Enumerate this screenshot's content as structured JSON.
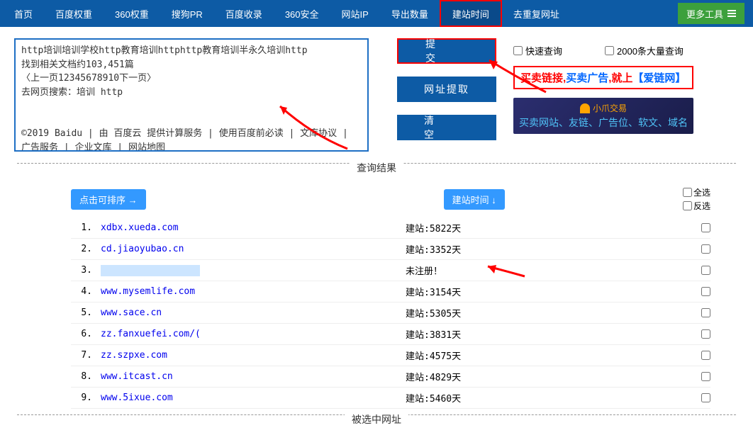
{
  "nav": {
    "items": [
      {
        "label": "首页"
      },
      {
        "label": "百度权重"
      },
      {
        "label": "360权重"
      },
      {
        "label": "搜狗PR"
      },
      {
        "label": "百度收录"
      },
      {
        "label": "360安全"
      },
      {
        "label": "网站IP"
      },
      {
        "label": "导出数量"
      },
      {
        "label": "建站时间",
        "active": true
      },
      {
        "label": "去重复网址"
      }
    ],
    "more_tools": "更多工具"
  },
  "textarea": {
    "content": "http培训培训学校http教育培训httphttp教育培训半永久培训http\n找到相关文档约103,451篇\n〈上一页12345678910下一页〉\n去网页搜索：培训 http\n\n\n©2019 Baidu | 由 百度云 提供计算服务 | 使用百度前必读 | 文库协议 | 广告服务 | 企业文库 | 网站地图"
  },
  "buttons": {
    "submit": "提交",
    "extract": "网址提取",
    "clear": "清空"
  },
  "options": {
    "fast_query": "快速查询",
    "bulk_query": "2000条大量查询"
  },
  "ads": {
    "ad1_parts": [
      {
        "text": "买卖链接",
        "cls": "ad-red"
      },
      {
        "text": ",",
        "cls": "ad-red"
      },
      {
        "text": "买卖广告",
        "cls": "ad-blue"
      },
      {
        "text": ",",
        "cls": "ad-red"
      },
      {
        "text": "就上",
        "cls": "ad-red"
      },
      {
        "text": "【爱链网】",
        "cls": "ad-blue"
      }
    ],
    "ad2_top": "小爪交易",
    "ad2_bot": "买卖网站、友链、广告位、软文、域名"
  },
  "results_header": {
    "title": "查询结果",
    "sort_label": "点击可排序 →",
    "time_label": "建站时间 ↓",
    "select_all": "全选",
    "invert": "反选"
  },
  "results": [
    {
      "num": "1.",
      "url": "xdbx.xueda.com",
      "time": "建站:5822天"
    },
    {
      "num": "2.",
      "url": "cd.jiaoyubao.cn",
      "time": "建站:3352天"
    },
    {
      "num": "3.",
      "url": "",
      "time": "未注册！",
      "hidden": true,
      "unreg": true
    },
    {
      "num": "4.",
      "url": "www.mysemlife.com",
      "time": "建站:3154天"
    },
    {
      "num": "5.",
      "url": "www.sace.cn",
      "time": "建站:5305天"
    },
    {
      "num": "6.",
      "url": "zz.fanxuefei.com/(",
      "time": "建站:3831天"
    },
    {
      "num": "7.",
      "url": "zz.szpxe.com",
      "time": "建站:4575天"
    },
    {
      "num": "8.",
      "url": "www.itcast.cn",
      "time": "建站:4829天"
    },
    {
      "num": "9.",
      "url": "www.5ixue.com",
      "time": "建站:5460天"
    }
  ],
  "footer_title": "被选中网址"
}
